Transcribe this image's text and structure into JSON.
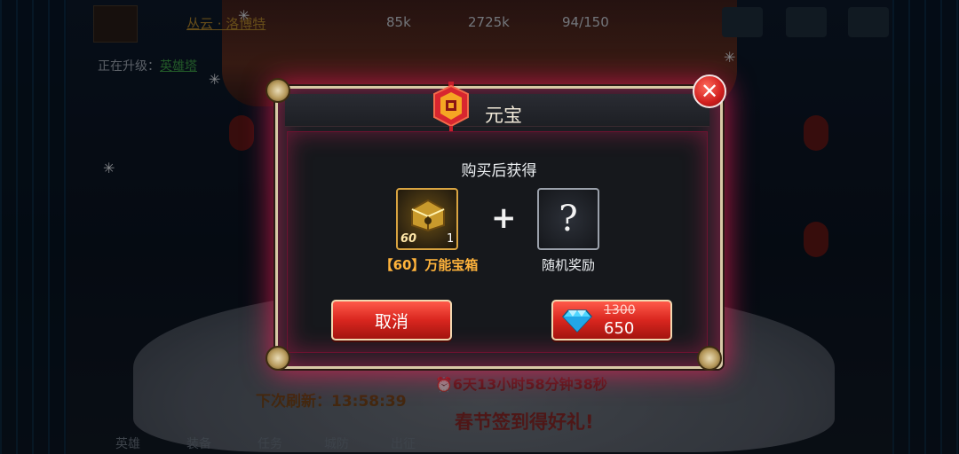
{
  "background": {
    "player_name": "丛云 · 洛博特",
    "upgrading_label": "正在升级：",
    "upgrading_value": "英雄塔",
    "res_gold": "85k",
    "res_elixir": "2725k",
    "res_energy": "94/150",
    "refresh_label": "下次刷新：13:58:39",
    "event_timer": "6天13小时58分钟38秒",
    "event_title": "春节签到得好礼!",
    "nav": [
      "英雄",
      "装备",
      "任务",
      "城防",
      "出征"
    ]
  },
  "dialog": {
    "title": "元宝",
    "subtitle": "购买后获得",
    "item1": {
      "name": "【60】万能宝箱",
      "level": "60",
      "count": "1"
    },
    "plus": "+",
    "item2": {
      "name": "随机奖励",
      "symbol": "?"
    },
    "cancel_label": "取消",
    "price_old": "1300",
    "price_new": "650",
    "close_symbol": "✕"
  },
  "colors": {
    "accent_glow": "#ff1e5a",
    "button_red": "#d9261f",
    "item_orange": "#ffb33b",
    "dialog_bg": "#1b1d22"
  },
  "icons": [
    "close-icon",
    "yuanbao-emblem-icon",
    "treasure-chest-icon",
    "question-mark-icon",
    "diamond-gem-icon",
    "alarm-clock-icon"
  ]
}
